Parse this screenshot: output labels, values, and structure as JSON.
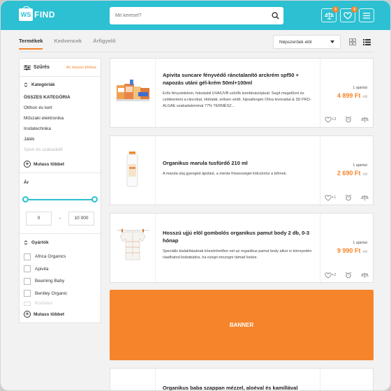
{
  "header": {
    "logo_badge": "WS",
    "logo_text": "FIND",
    "search_placeholder": "Mit keresel?",
    "compare_count": "3",
    "favorites_count": "3"
  },
  "tabs": [
    {
      "label": "Termékek",
      "active": true
    },
    {
      "label": "Kedvencek",
      "active": false
    },
    {
      "label": "Árfigyelő",
      "active": false
    }
  ],
  "sort": {
    "selected": "Népszerűek elöl"
  },
  "sidebar": {
    "title": "Szűrés",
    "clear_label": "Az összes törlése",
    "categories_title": "Kategóriák",
    "categories": [
      "ÖSSZES KATEGÓRIA",
      "Otthon és kert",
      "Műszaki elektronika",
      "Irodatechnika",
      "Játék",
      "Sport és szabadidő"
    ],
    "show_more": "Mutass többet",
    "price_title": "Ár",
    "price_min": "0",
    "price_sep": "-",
    "price_max": "10 000",
    "brands_title": "Gyártók",
    "brands": [
      "Africa Organics",
      "Apivita",
      "Beaming Baby",
      "Bentley Organic",
      "Bonfalke"
    ],
    "brands_more": "Mutass többet"
  },
  "products": [
    {
      "title": "Apivita suncare fényvédő ránctalanító arckrém spf50 + napozás utáni gél-krém 50ml+100ml",
      "description": "Erős fényvédelem, fotostabil UVA/UVB szűrők kombinációjával. Segít megelőzni és csökkenteni a ráncokat. Hidratál, erősen védő, hipoallergén Olíva kivonattal & 3D PRO-ALGAE szabadalommal 77% TERMÉSZ...",
      "offers": "1 ajánlat",
      "price": "4 899 Ft",
      "price_suffix": "-tól",
      "fav_count": "+3"
    },
    {
      "title": "Organikus marula tusfürdő 210 ml",
      "description": "A marula olaj gyengéd ápolást, a menta frissességet kölcsönöz a bőrnek.",
      "offers": "1 ajánlat",
      "price": "2 690 Ft",
      "price_suffix": "-tól",
      "fav_count": "+1"
    },
    {
      "title": "Hosszú ujjú elöl gombolós organikus pamut body 2 db, 0-3 hónap",
      "description": "Speciális kialakításának köszönhetően ezt az organikus pamut body alkor is könnyedén ráadhatod kisbabádra, ha ezegri-mozogni támad kedve.",
      "offers": "1 ajánlat",
      "price": "9 990 Ft",
      "price_suffix": "-tól",
      "fav_count": "+2"
    },
    {
      "title": "Organikus baba szappan mézzel, aloéval és kamillával"
    }
  ],
  "banner": {
    "label": "BANNER"
  },
  "colors": {
    "accent": "#2cc0d2",
    "brand_orange": "#f5842b"
  }
}
